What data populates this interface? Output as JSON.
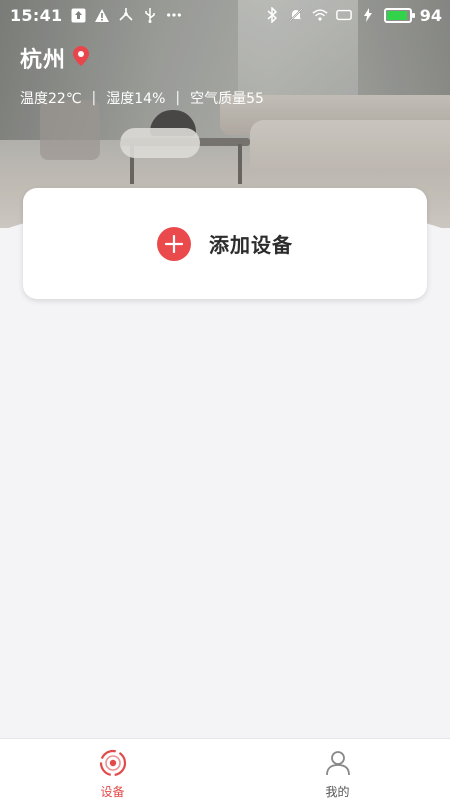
{
  "status_bar": {
    "time": "15:41",
    "battery_percent": "94",
    "battery_level": 0.94,
    "left_icons": [
      "upload-icon",
      "warning-icon",
      "share-network-icon",
      "usb-icon",
      "more-dots-icon"
    ],
    "right_icons": [
      "bluetooth-icon",
      "mute-bell-icon",
      "wifi-icon",
      "screen-icon",
      "charging-bolt-icon",
      "battery-icon"
    ]
  },
  "location": {
    "city": "杭州",
    "icon": "location-pin-icon",
    "pin_color": "#e9464c"
  },
  "weather": {
    "temperature": "温度22℃",
    "humidity": "湿度14%",
    "air_quality": "空气质量55",
    "separator": "|"
  },
  "add_device": {
    "label": "添加设备",
    "icon": "plus-circle-icon",
    "accent": "#ea4a4c"
  },
  "tabbar": {
    "tabs": [
      {
        "label": "设备",
        "icon": "device-tab-icon",
        "active": true,
        "color": "#e34a4a"
      },
      {
        "label": "我的",
        "icon": "user-profile-icon",
        "active": false,
        "color": "#555555"
      }
    ]
  }
}
